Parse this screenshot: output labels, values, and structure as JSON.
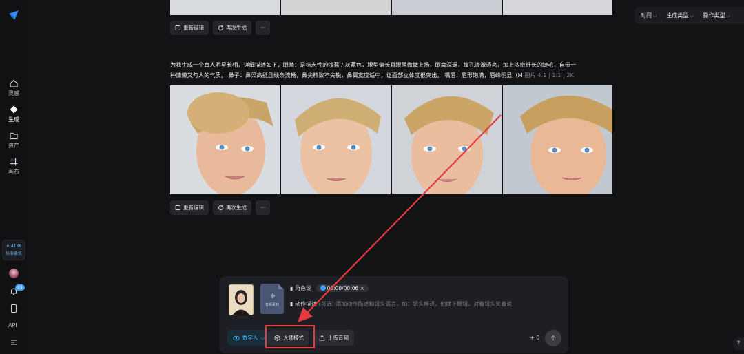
{
  "sidebar": {
    "items": [
      {
        "label": "灵感",
        "icon": "home-icon"
      },
      {
        "label": "生成",
        "icon": "diamond-icon"
      },
      {
        "label": "资产",
        "icon": "folder-icon"
      },
      {
        "label": "画布",
        "icon": "canvas-grid-icon"
      }
    ],
    "credits": "4188",
    "tier": "标准会员",
    "notification_badge": "99",
    "api_label": "API"
  },
  "filters": {
    "time": "时间",
    "gen_type": "生成类型",
    "op_type": "操作类型"
  },
  "actions": {
    "reedit": "重新编辑",
    "regenerate": "再次生成",
    "more": "···"
  },
  "prompt": {
    "line1": "为我生成一个真人明星长相，详细描述如下，眼睛：是标志性的浅蓝 / 灰蓝色，眼型偏长且眼尾微微上扬，眼窝深邃，瞳孔清澈透亮，加上浓密纤长的睫毛，自带一",
    "line2": "种慵懒又勾人的气质。 鼻子：鼻梁高挺且线条流畅，鼻尖精致不尖锐，鼻翼宽度适中，让面部立体度很突出。 嘴唇：唇形饱满，唇峰明显（M",
    "meta": "图片 4.1  |  1:1  |  2K"
  },
  "composer": {
    "audio_card_label": "音频素材",
    "character_label": "角色说",
    "time_current": "00:00",
    "time_total": "/00:06",
    "action_label": "动作描述",
    "action_hint": "(可选) 添加动作描述和镜头语言，如：镜头推进，他摘下眼镜，对着镜头笑着说",
    "mode_label": "数字人",
    "master_mode_label": "大师模式",
    "upload_audio_label": "上传音频",
    "count": "+ 0"
  },
  "help": "?",
  "colors": {
    "accent": "#3aa0ff",
    "highlight": "#e8393f",
    "background": "#131316"
  }
}
